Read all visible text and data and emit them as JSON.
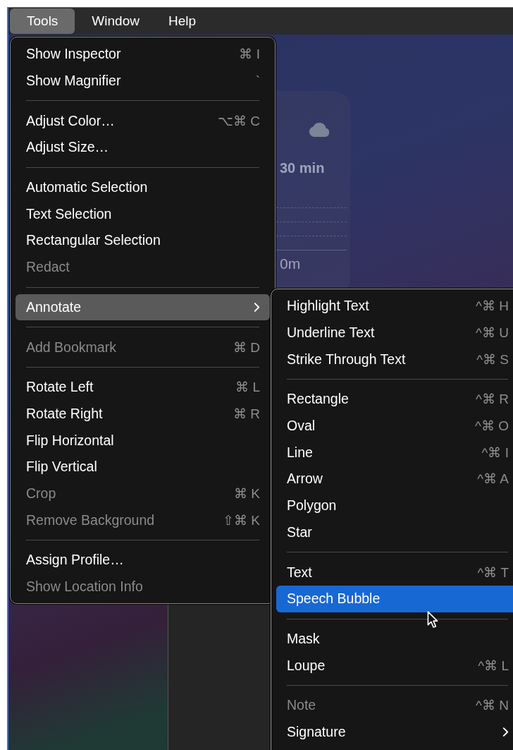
{
  "menubar": [
    {
      "label": "Tools",
      "selected": true
    },
    {
      "label": "Window",
      "selected": false
    },
    {
      "label": "Help",
      "selected": false
    }
  ],
  "widget": {
    "duration": "30 min",
    "distance": "0m"
  },
  "tools_menu": {
    "focused": false,
    "items": [
      {
        "kind": "item",
        "label": "Show Inspector",
        "shortcut": "⌘ I",
        "disabled": false,
        "selected": false,
        "submenu": false
      },
      {
        "kind": "item",
        "label": "Show Magnifier",
        "shortcut": "`",
        "disabled": false,
        "selected": false,
        "submenu": false
      },
      {
        "kind": "separator"
      },
      {
        "kind": "item",
        "label": "Adjust Color…",
        "shortcut": "⌥⌘ C",
        "disabled": false,
        "selected": false,
        "submenu": false
      },
      {
        "kind": "item",
        "label": "Adjust Size…",
        "disabled": false,
        "selected": false,
        "submenu": false
      },
      {
        "kind": "separator"
      },
      {
        "kind": "item",
        "label": "Automatic Selection",
        "disabled": false,
        "selected": false,
        "submenu": false
      },
      {
        "kind": "item",
        "label": "Text Selection",
        "disabled": false,
        "selected": false,
        "submenu": false
      },
      {
        "kind": "item",
        "label": "Rectangular Selection",
        "disabled": false,
        "selected": false,
        "submenu": false
      },
      {
        "kind": "item",
        "label": "Redact",
        "disabled": true,
        "selected": false,
        "submenu": false
      },
      {
        "kind": "separator"
      },
      {
        "kind": "item",
        "label": "Annotate",
        "disabled": false,
        "selected": true,
        "submenu": true
      },
      {
        "kind": "separator"
      },
      {
        "kind": "item",
        "label": "Add Bookmark",
        "shortcut": "⌘ D",
        "disabled": true,
        "selected": false,
        "submenu": false
      },
      {
        "kind": "separator"
      },
      {
        "kind": "item",
        "label": "Rotate Left",
        "shortcut": "⌘ L",
        "disabled": false,
        "selected": false,
        "submenu": false
      },
      {
        "kind": "item",
        "label": "Rotate Right",
        "shortcut": "⌘ R",
        "disabled": false,
        "selected": false,
        "submenu": false
      },
      {
        "kind": "item",
        "label": "Flip Horizontal",
        "disabled": false,
        "selected": false,
        "submenu": false
      },
      {
        "kind": "item",
        "label": "Flip Vertical",
        "disabled": false,
        "selected": false,
        "submenu": false
      },
      {
        "kind": "item",
        "label": "Crop",
        "shortcut": "⌘ K",
        "disabled": true,
        "selected": false,
        "submenu": false
      },
      {
        "kind": "item",
        "label": "Remove Background",
        "shortcut": "⇧⌘ K",
        "disabled": true,
        "selected": false,
        "submenu": false
      },
      {
        "kind": "separator"
      },
      {
        "kind": "item",
        "label": "Assign Profile…",
        "disabled": false,
        "selected": false,
        "submenu": false
      },
      {
        "kind": "item",
        "label": "Show Location Info",
        "disabled": true,
        "selected": false,
        "submenu": false
      }
    ]
  },
  "annotate_submenu": {
    "focused": true,
    "items": [
      {
        "kind": "item",
        "label": "Highlight Text",
        "shortcut": "^⌘ H",
        "disabled": false,
        "selected": false,
        "submenu": false
      },
      {
        "kind": "item",
        "label": "Underline Text",
        "shortcut": "^⌘ U",
        "disabled": false,
        "selected": false,
        "submenu": false
      },
      {
        "kind": "item",
        "label": "Strike Through Text",
        "shortcut": "^⌘ S",
        "disabled": false,
        "selected": false,
        "submenu": false
      },
      {
        "kind": "separator"
      },
      {
        "kind": "item",
        "label": "Rectangle",
        "shortcut": "^⌘ R",
        "disabled": false,
        "selected": false,
        "submenu": false
      },
      {
        "kind": "item",
        "label": "Oval",
        "shortcut": "^⌘ O",
        "disabled": false,
        "selected": false,
        "submenu": false
      },
      {
        "kind": "item",
        "label": "Line",
        "shortcut": "^⌘ I",
        "disabled": false,
        "selected": false,
        "submenu": false
      },
      {
        "kind": "item",
        "label": "Arrow",
        "shortcut": "^⌘ A",
        "disabled": false,
        "selected": false,
        "submenu": false
      },
      {
        "kind": "item",
        "label": "Polygon",
        "disabled": false,
        "selected": false,
        "submenu": false
      },
      {
        "kind": "item",
        "label": "Star",
        "disabled": false,
        "selected": false,
        "submenu": false
      },
      {
        "kind": "separator"
      },
      {
        "kind": "item",
        "label": "Text",
        "shortcut": "^⌘ T",
        "disabled": false,
        "selected": false,
        "submenu": false
      },
      {
        "kind": "item",
        "label": "Speech Bubble",
        "disabled": false,
        "selected": true,
        "submenu": false
      },
      {
        "kind": "separator"
      },
      {
        "kind": "item",
        "label": "Mask",
        "disabled": false,
        "selected": false,
        "submenu": false
      },
      {
        "kind": "item",
        "label": "Loupe",
        "shortcut": "^⌘ L",
        "disabled": false,
        "selected": false,
        "submenu": false
      },
      {
        "kind": "separator"
      },
      {
        "kind": "item",
        "label": "Note",
        "shortcut": "^⌘ N",
        "disabled": true,
        "selected": false,
        "submenu": false
      },
      {
        "kind": "item",
        "label": "Signature",
        "disabled": false,
        "selected": false,
        "submenu": true
      }
    ]
  }
}
